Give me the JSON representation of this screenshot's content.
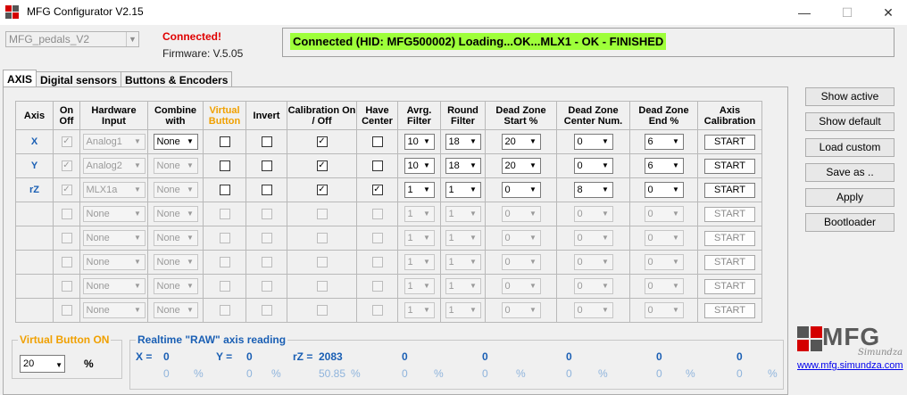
{
  "window": {
    "title": "MFG Configurator V2.15",
    "minimize": "—",
    "maximize": "☐",
    "close": "✕"
  },
  "device": {
    "selected": "MFG_pedals_V2",
    "status": "Connected!",
    "firmware": "Firmware: V.5.05"
  },
  "status_message": "Connected (HID: MFG500002) Loading...OK...MLX1 - OK  -  FINISHED",
  "tabs": [
    "AXIS",
    "Digital sensors",
    "Buttons & Encoders"
  ],
  "table": {
    "headers": {
      "axis": "Axis",
      "onoff": "On Off",
      "hw": "Hardware Input",
      "combine": "Combine with",
      "virtual": "Virtual Button",
      "invert": "Invert",
      "calib": "Calibration On / Off",
      "center": "Have Center",
      "avrg": "Avrg. Filter",
      "round": "Round Filter",
      "dzstart": "Dead Zone Start %",
      "dzcenter": "Dead Zone Center Num.",
      "dzend": "Dead Zone End %",
      "axcal": "Axis Calibration"
    },
    "rows": [
      {
        "axis": "X",
        "hw": "Analog1",
        "combine": "None",
        "avrg": "10",
        "round": "18",
        "dzstart": "20",
        "dzcenter": "0",
        "dzend": "6",
        "btn": "START"
      },
      {
        "axis": "Y",
        "hw": "Analog2",
        "combine": "None",
        "avrg": "10",
        "round": "18",
        "dzstart": "20",
        "dzcenter": "0",
        "dzend": "6",
        "btn": "START"
      },
      {
        "axis": "rZ",
        "hw": "MLX1a",
        "combine": "None",
        "avrg": "1",
        "round": "1",
        "dzstart": "0",
        "dzcenter": "8",
        "dzend": "0",
        "btn": "START"
      },
      {
        "axis": "",
        "hw": "None",
        "combine": "None",
        "avrg": "1",
        "round": "1",
        "dzstart": "0",
        "dzcenter": "0",
        "dzend": "0",
        "btn": "START"
      },
      {
        "axis": "",
        "hw": "None",
        "combine": "None",
        "avrg": "1",
        "round": "1",
        "dzstart": "0",
        "dzcenter": "0",
        "dzend": "0",
        "btn": "START"
      },
      {
        "axis": "",
        "hw": "None",
        "combine": "None",
        "avrg": "1",
        "round": "1",
        "dzstart": "0",
        "dzcenter": "0",
        "dzend": "0",
        "btn": "START"
      },
      {
        "axis": "",
        "hw": "None",
        "combine": "None",
        "avrg": "1",
        "round": "1",
        "dzstart": "0",
        "dzcenter": "0",
        "dzend": "0",
        "btn": "START"
      },
      {
        "axis": "",
        "hw": "None",
        "combine": "None",
        "avrg": "1",
        "round": "1",
        "dzstart": "0",
        "dzcenter": "0",
        "dzend": "0",
        "btn": "START"
      }
    ]
  },
  "side_buttons": [
    "Show active",
    "Show default",
    "Load custom",
    "Save as ..",
    "Apply",
    "Bootloader"
  ],
  "virtual_button_on": {
    "title": "Virtual Button ON",
    "value": "20",
    "unit": "%"
  },
  "realtime": {
    "title": "Realtime \"RAW\" axis reading",
    "x_label": "X =",
    "x_value": "0",
    "y_label": "Y =",
    "y_value": "0",
    "rz_label": "rZ =",
    "rz_value": "2083",
    "extra_values": [
      "0",
      "0",
      "0",
      "0",
      "0"
    ],
    "percents": [
      "0",
      "0",
      "50.85",
      "0",
      "0",
      "0",
      "0",
      "0"
    ],
    "percent_sign": "%"
  },
  "logo": {
    "text": "MFG",
    "signature": "Simundza",
    "link": "www.mfg.simundza.com"
  },
  "colors": {
    "status_bg": "#9eff3a",
    "connected": "#e00000",
    "accent_blue": "#1a5fb4",
    "orange": "#f0a000"
  }
}
